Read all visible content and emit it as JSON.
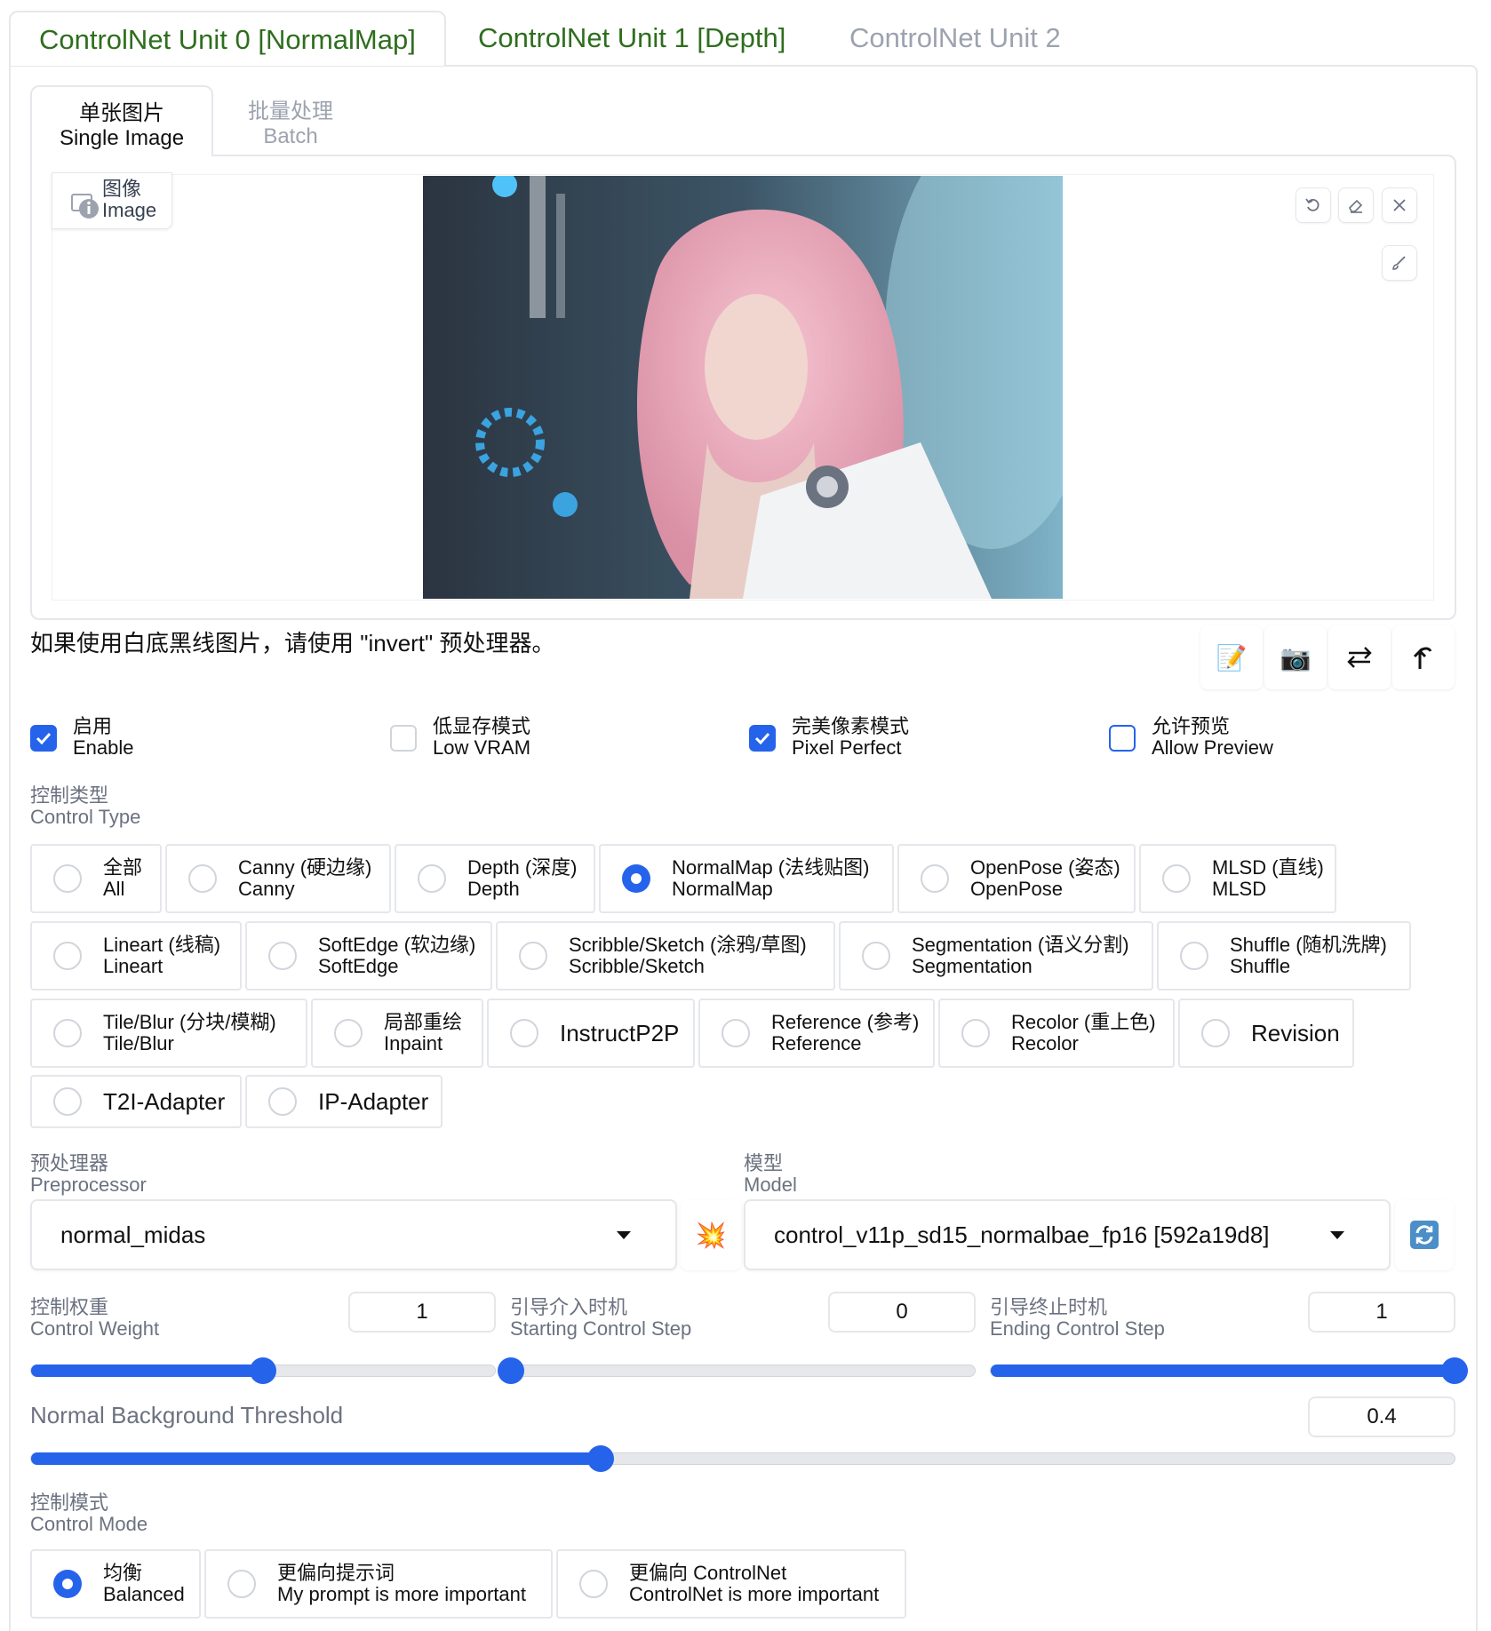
{
  "unit_tabs": [
    {
      "label": "ControlNet Unit 0 [NormalMap]"
    },
    {
      "label": "ControlNet Unit 1 [Depth]"
    },
    {
      "label": "ControlNet Unit 2"
    }
  ],
  "image_tabs": {
    "single_zh": "单张图片",
    "single_en": "Single Image",
    "batch_zh": "批量处理",
    "batch_en": "Batch"
  },
  "image_label": {
    "zh": "图像",
    "en": "Image"
  },
  "hint": "如果使用白底黑线图片，请使用 \"invert\" 预处理器。",
  "checkboxes": [
    {
      "zh": "启用",
      "en": "Enable",
      "checked": true
    },
    {
      "zh": "低显存模式",
      "en": "Low VRAM",
      "checked": false
    },
    {
      "zh": "完美像素模式",
      "en": "Pixel Perfect",
      "checked": true
    },
    {
      "zh": "允许预览",
      "en": "Allow Preview",
      "checked": false
    }
  ],
  "control_type": {
    "label_zh": "控制类型",
    "label_en": "Control Type",
    "options": [
      {
        "zh": "全部",
        "en": "All"
      },
      {
        "zh": "Canny (硬边缘)",
        "en": "Canny"
      },
      {
        "zh": "Depth (深度)",
        "en": "Depth"
      },
      {
        "zh": "NormalMap (法线贴图)",
        "en": "NormalMap",
        "selected": true
      },
      {
        "zh": "OpenPose (姿态)",
        "en": "OpenPose"
      },
      {
        "zh": "MLSD (直线)",
        "en": "MLSD"
      },
      {
        "zh": "Lineart (线稿)",
        "en": "Lineart"
      },
      {
        "zh": "SoftEdge (软边缘)",
        "en": "SoftEdge"
      },
      {
        "zh": "Scribble/Sketch (涂鸦/草图)",
        "en": "Scribble/Sketch"
      },
      {
        "zh": "Segmentation (语义分割)",
        "en": "Segmentation"
      },
      {
        "zh": "Shuffle (随机洗牌)",
        "en": "Shuffle"
      },
      {
        "zh": "Tile/Blur (分块/模糊)",
        "en": "Tile/Blur"
      },
      {
        "zh": "局部重绘",
        "en": "Inpaint"
      },
      {
        "single": "InstructP2P"
      },
      {
        "zh": "Reference (参考)",
        "en": "Reference"
      },
      {
        "zh": "Recolor (重上色)",
        "en": "Recolor"
      },
      {
        "single": "Revision"
      },
      {
        "single": "T2I-Adapter"
      },
      {
        "single": "IP-Adapter"
      }
    ]
  },
  "preprocessor": {
    "label_zh": "预处理器",
    "label_en": "Preprocessor",
    "value": "normal_midas"
  },
  "model": {
    "label_zh": "模型",
    "label_en": "Model",
    "value": "control_v11p_sd15_normalbae_fp16 [592a19d8]"
  },
  "sliders": {
    "weight": {
      "label_zh": "控制权重",
      "label_en": "Control Weight",
      "value": "1",
      "fraction": 0.5
    },
    "start": {
      "label_zh": "引导介入时机",
      "label_en": "Starting Control Step",
      "value": "0",
      "fraction": 0.0
    },
    "end": {
      "label_zh": "引导终止时机",
      "label_en": "Ending Control Step",
      "value": "1",
      "fraction": 1.0
    },
    "threshold": {
      "label": "Normal Background Threshold",
      "value": "0.4",
      "fraction": 0.4
    }
  },
  "control_mode": {
    "label_zh": "控制模式",
    "label_en": "Control Mode",
    "options": [
      {
        "zh": "均衡",
        "en": "Balanced",
        "selected": true
      },
      {
        "zh": "更偏向提示词",
        "en": "My prompt is more important"
      },
      {
        "zh": "更偏向 ControlNet",
        "en": "ControlNet is more important"
      }
    ]
  },
  "icons": {
    "undo": "undo-icon",
    "eraser": "eraser-icon",
    "close": "close-icon",
    "brush": "brush-icon",
    "edit": "memo-icon",
    "camera": "camera-icon",
    "swap": "swap-icon",
    "send": "send-up-icon",
    "explode": "explosion-icon",
    "refresh": "refresh-icon"
  },
  "colors": {
    "accent": "#2563eb",
    "tab_active": "#2e6e1e",
    "muted": "#9ca3af"
  }
}
